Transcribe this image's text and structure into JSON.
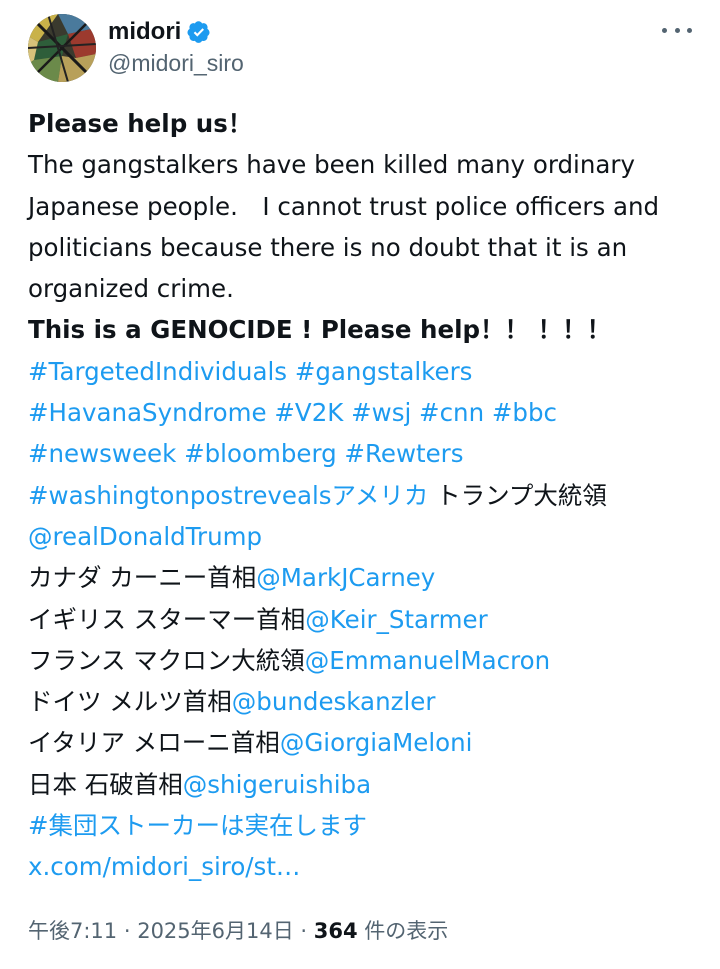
{
  "author": {
    "display_name": "midori",
    "handle": "@midori_siro",
    "verified_icon": "verified-badge-icon",
    "avatar_icon": "stained-glass-avatar"
  },
  "menu_icon": "more-options-icon",
  "colors": {
    "link": "#1d9bf0",
    "text": "#0f1419",
    "muted": "#536471"
  },
  "tweet": {
    "l1": "Please help us！",
    "l2": "The gangstalkers have been killed many ordinary",
    "l3": "Japanese people.　I cannot trust police officers and",
    "l4": "politicians because there is no doubt that it is an",
    "l5": "organized crime.",
    "l6": "This is a GENOCIDE ! Please help！！ ！！！",
    "l7": "#TargetedIndividuals #gangstalkers",
    "l8": "#HavanaSyndrome #V2K #wsj #cnn #bbc",
    "l9": "#newsweek #bloomberg #Rewters",
    "l10_link": "#washingtonpostrevealsアメリカ",
    "l10_text": " トランプ大統領",
    "l11": "@realDonaldTrump",
    "l12_text": "カナダ カーニー首相",
    "l12_link": "@MarkJCarney",
    "l13_text": "イギリス スターマー首相",
    "l13_link": "@Keir_Starmer",
    "l14_text": "フランス マクロン大統領",
    "l14_link": "@EmmanuelMacron",
    "l15_text": "ドイツ メルツ首相",
    "l15_link": "@bundeskanzler",
    "l16_text": "イタリア メローニ首相",
    "l16_link": "@GiorgiaMeloni",
    "l17_text": "日本 石破首相",
    "l17_link": "@shigeruishiba",
    "l18": "#集団ストーカーは実在します",
    "l19": "x.com/midori_siro/st…"
  },
  "meta": {
    "time": "午後7:11",
    "sep1": " · ",
    "date": "2025年6月14日",
    "sep2": " · ",
    "views_count": "364",
    "views_label": " 件の表示"
  }
}
